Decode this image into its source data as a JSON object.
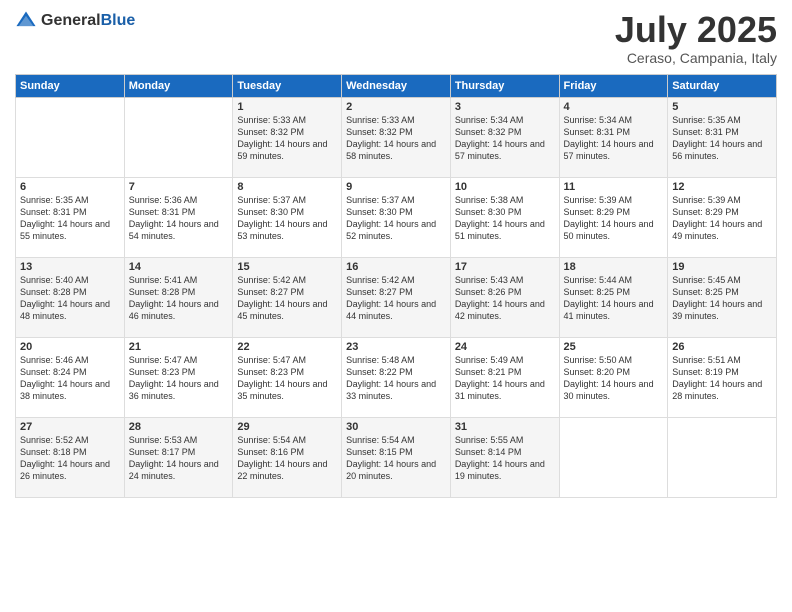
{
  "header": {
    "logo": {
      "general": "General",
      "blue": "Blue"
    },
    "month": "July 2025",
    "location": "Ceraso, Campania, Italy"
  },
  "weekdays": [
    "Sunday",
    "Monday",
    "Tuesday",
    "Wednesday",
    "Thursday",
    "Friday",
    "Saturday"
  ],
  "weeks": [
    [
      {
        "day": "",
        "sunrise": "",
        "sunset": "",
        "daylight": ""
      },
      {
        "day": "",
        "sunrise": "",
        "sunset": "",
        "daylight": ""
      },
      {
        "day": "1",
        "sunrise": "Sunrise: 5:33 AM",
        "sunset": "Sunset: 8:32 PM",
        "daylight": "Daylight: 14 hours and 59 minutes."
      },
      {
        "day": "2",
        "sunrise": "Sunrise: 5:33 AM",
        "sunset": "Sunset: 8:32 PM",
        "daylight": "Daylight: 14 hours and 58 minutes."
      },
      {
        "day": "3",
        "sunrise": "Sunrise: 5:34 AM",
        "sunset": "Sunset: 8:32 PM",
        "daylight": "Daylight: 14 hours and 57 minutes."
      },
      {
        "day": "4",
        "sunrise": "Sunrise: 5:34 AM",
        "sunset": "Sunset: 8:31 PM",
        "daylight": "Daylight: 14 hours and 57 minutes."
      },
      {
        "day": "5",
        "sunrise": "Sunrise: 5:35 AM",
        "sunset": "Sunset: 8:31 PM",
        "daylight": "Daylight: 14 hours and 56 minutes."
      }
    ],
    [
      {
        "day": "6",
        "sunrise": "Sunrise: 5:35 AM",
        "sunset": "Sunset: 8:31 PM",
        "daylight": "Daylight: 14 hours and 55 minutes."
      },
      {
        "day": "7",
        "sunrise": "Sunrise: 5:36 AM",
        "sunset": "Sunset: 8:31 PM",
        "daylight": "Daylight: 14 hours and 54 minutes."
      },
      {
        "day": "8",
        "sunrise": "Sunrise: 5:37 AM",
        "sunset": "Sunset: 8:30 PM",
        "daylight": "Daylight: 14 hours and 53 minutes."
      },
      {
        "day": "9",
        "sunrise": "Sunrise: 5:37 AM",
        "sunset": "Sunset: 8:30 PM",
        "daylight": "Daylight: 14 hours and 52 minutes."
      },
      {
        "day": "10",
        "sunrise": "Sunrise: 5:38 AM",
        "sunset": "Sunset: 8:30 PM",
        "daylight": "Daylight: 14 hours and 51 minutes."
      },
      {
        "day": "11",
        "sunrise": "Sunrise: 5:39 AM",
        "sunset": "Sunset: 8:29 PM",
        "daylight": "Daylight: 14 hours and 50 minutes."
      },
      {
        "day": "12",
        "sunrise": "Sunrise: 5:39 AM",
        "sunset": "Sunset: 8:29 PM",
        "daylight": "Daylight: 14 hours and 49 minutes."
      }
    ],
    [
      {
        "day": "13",
        "sunrise": "Sunrise: 5:40 AM",
        "sunset": "Sunset: 8:28 PM",
        "daylight": "Daylight: 14 hours and 48 minutes."
      },
      {
        "day": "14",
        "sunrise": "Sunrise: 5:41 AM",
        "sunset": "Sunset: 8:28 PM",
        "daylight": "Daylight: 14 hours and 46 minutes."
      },
      {
        "day": "15",
        "sunrise": "Sunrise: 5:42 AM",
        "sunset": "Sunset: 8:27 PM",
        "daylight": "Daylight: 14 hours and 45 minutes."
      },
      {
        "day": "16",
        "sunrise": "Sunrise: 5:42 AM",
        "sunset": "Sunset: 8:27 PM",
        "daylight": "Daylight: 14 hours and 44 minutes."
      },
      {
        "day": "17",
        "sunrise": "Sunrise: 5:43 AM",
        "sunset": "Sunset: 8:26 PM",
        "daylight": "Daylight: 14 hours and 42 minutes."
      },
      {
        "day": "18",
        "sunrise": "Sunrise: 5:44 AM",
        "sunset": "Sunset: 8:25 PM",
        "daylight": "Daylight: 14 hours and 41 minutes."
      },
      {
        "day": "19",
        "sunrise": "Sunrise: 5:45 AM",
        "sunset": "Sunset: 8:25 PM",
        "daylight": "Daylight: 14 hours and 39 minutes."
      }
    ],
    [
      {
        "day": "20",
        "sunrise": "Sunrise: 5:46 AM",
        "sunset": "Sunset: 8:24 PM",
        "daylight": "Daylight: 14 hours and 38 minutes."
      },
      {
        "day": "21",
        "sunrise": "Sunrise: 5:47 AM",
        "sunset": "Sunset: 8:23 PM",
        "daylight": "Daylight: 14 hours and 36 minutes."
      },
      {
        "day": "22",
        "sunrise": "Sunrise: 5:47 AM",
        "sunset": "Sunset: 8:23 PM",
        "daylight": "Daylight: 14 hours and 35 minutes."
      },
      {
        "day": "23",
        "sunrise": "Sunrise: 5:48 AM",
        "sunset": "Sunset: 8:22 PM",
        "daylight": "Daylight: 14 hours and 33 minutes."
      },
      {
        "day": "24",
        "sunrise": "Sunrise: 5:49 AM",
        "sunset": "Sunset: 8:21 PM",
        "daylight": "Daylight: 14 hours and 31 minutes."
      },
      {
        "day": "25",
        "sunrise": "Sunrise: 5:50 AM",
        "sunset": "Sunset: 8:20 PM",
        "daylight": "Daylight: 14 hours and 30 minutes."
      },
      {
        "day": "26",
        "sunrise": "Sunrise: 5:51 AM",
        "sunset": "Sunset: 8:19 PM",
        "daylight": "Daylight: 14 hours and 28 minutes."
      }
    ],
    [
      {
        "day": "27",
        "sunrise": "Sunrise: 5:52 AM",
        "sunset": "Sunset: 8:18 PM",
        "daylight": "Daylight: 14 hours and 26 minutes."
      },
      {
        "day": "28",
        "sunrise": "Sunrise: 5:53 AM",
        "sunset": "Sunset: 8:17 PM",
        "daylight": "Daylight: 14 hours and 24 minutes."
      },
      {
        "day": "29",
        "sunrise": "Sunrise: 5:54 AM",
        "sunset": "Sunset: 8:16 PM",
        "daylight": "Daylight: 14 hours and 22 minutes."
      },
      {
        "day": "30",
        "sunrise": "Sunrise: 5:54 AM",
        "sunset": "Sunset: 8:15 PM",
        "daylight": "Daylight: 14 hours and 20 minutes."
      },
      {
        "day": "31",
        "sunrise": "Sunrise: 5:55 AM",
        "sunset": "Sunset: 8:14 PM",
        "daylight": "Daylight: 14 hours and 19 minutes."
      },
      {
        "day": "",
        "sunrise": "",
        "sunset": "",
        "daylight": ""
      },
      {
        "day": "",
        "sunrise": "",
        "sunset": "",
        "daylight": ""
      }
    ]
  ]
}
